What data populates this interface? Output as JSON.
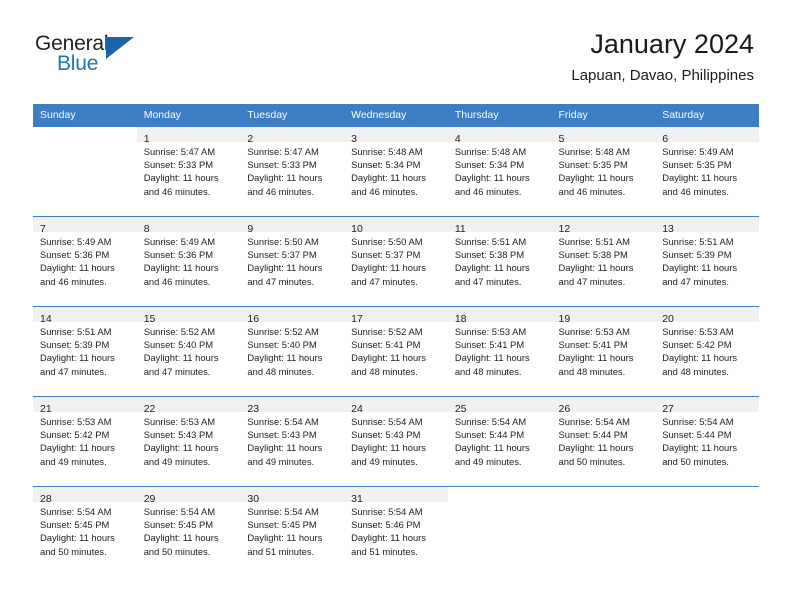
{
  "brand": {
    "name_part1": "General",
    "name_part2": "Blue",
    "accent_color": "#1c75bc",
    "triangle_color": "#1b63ad"
  },
  "header": {
    "title": "January 2024",
    "location": "Lapuan, Davao, Philippines"
  },
  "calendar": {
    "header_bg": "#3d7dc4",
    "daynum_band_bg": "#f0f0f0",
    "weekdays": [
      "Sunday",
      "Monday",
      "Tuesday",
      "Wednesday",
      "Thursday",
      "Friday",
      "Saturday"
    ],
    "weeks": [
      [
        {
          "day": "",
          "sunrise": "",
          "sunset": "",
          "daylight_line1": "",
          "daylight_line2": "",
          "empty": true
        },
        {
          "day": "1",
          "sunrise": "Sunrise: 5:47 AM",
          "sunset": "Sunset: 5:33 PM",
          "daylight_line1": "Daylight: 11 hours",
          "daylight_line2": "and 46 minutes."
        },
        {
          "day": "2",
          "sunrise": "Sunrise: 5:47 AM",
          "sunset": "Sunset: 5:33 PM",
          "daylight_line1": "Daylight: 11 hours",
          "daylight_line2": "and 46 minutes."
        },
        {
          "day": "3",
          "sunrise": "Sunrise: 5:48 AM",
          "sunset": "Sunset: 5:34 PM",
          "daylight_line1": "Daylight: 11 hours",
          "daylight_line2": "and 46 minutes."
        },
        {
          "day": "4",
          "sunrise": "Sunrise: 5:48 AM",
          "sunset": "Sunset: 5:34 PM",
          "daylight_line1": "Daylight: 11 hours",
          "daylight_line2": "and 46 minutes."
        },
        {
          "day": "5",
          "sunrise": "Sunrise: 5:48 AM",
          "sunset": "Sunset: 5:35 PM",
          "daylight_line1": "Daylight: 11 hours",
          "daylight_line2": "and 46 minutes."
        },
        {
          "day": "6",
          "sunrise": "Sunrise: 5:49 AM",
          "sunset": "Sunset: 5:35 PM",
          "daylight_line1": "Daylight: 11 hours",
          "daylight_line2": "and 46 minutes."
        }
      ],
      [
        {
          "day": "7",
          "sunrise": "Sunrise: 5:49 AM",
          "sunset": "Sunset: 5:36 PM",
          "daylight_line1": "Daylight: 11 hours",
          "daylight_line2": "and 46 minutes."
        },
        {
          "day": "8",
          "sunrise": "Sunrise: 5:49 AM",
          "sunset": "Sunset: 5:36 PM",
          "daylight_line1": "Daylight: 11 hours",
          "daylight_line2": "and 46 minutes."
        },
        {
          "day": "9",
          "sunrise": "Sunrise: 5:50 AM",
          "sunset": "Sunset: 5:37 PM",
          "daylight_line1": "Daylight: 11 hours",
          "daylight_line2": "and 47 minutes."
        },
        {
          "day": "10",
          "sunrise": "Sunrise: 5:50 AM",
          "sunset": "Sunset: 5:37 PM",
          "daylight_line1": "Daylight: 11 hours",
          "daylight_line2": "and 47 minutes."
        },
        {
          "day": "11",
          "sunrise": "Sunrise: 5:51 AM",
          "sunset": "Sunset: 5:38 PM",
          "daylight_line1": "Daylight: 11 hours",
          "daylight_line2": "and 47 minutes."
        },
        {
          "day": "12",
          "sunrise": "Sunrise: 5:51 AM",
          "sunset": "Sunset: 5:38 PM",
          "daylight_line1": "Daylight: 11 hours",
          "daylight_line2": "and 47 minutes."
        },
        {
          "day": "13",
          "sunrise": "Sunrise: 5:51 AM",
          "sunset": "Sunset: 5:39 PM",
          "daylight_line1": "Daylight: 11 hours",
          "daylight_line2": "and 47 minutes."
        }
      ],
      [
        {
          "day": "14",
          "sunrise": "Sunrise: 5:51 AM",
          "sunset": "Sunset: 5:39 PM",
          "daylight_line1": "Daylight: 11 hours",
          "daylight_line2": "and 47 minutes."
        },
        {
          "day": "15",
          "sunrise": "Sunrise: 5:52 AM",
          "sunset": "Sunset: 5:40 PM",
          "daylight_line1": "Daylight: 11 hours",
          "daylight_line2": "and 47 minutes."
        },
        {
          "day": "16",
          "sunrise": "Sunrise: 5:52 AM",
          "sunset": "Sunset: 5:40 PM",
          "daylight_line1": "Daylight: 11 hours",
          "daylight_line2": "and 48 minutes."
        },
        {
          "day": "17",
          "sunrise": "Sunrise: 5:52 AM",
          "sunset": "Sunset: 5:41 PM",
          "daylight_line1": "Daylight: 11 hours",
          "daylight_line2": "and 48 minutes."
        },
        {
          "day": "18",
          "sunrise": "Sunrise: 5:53 AM",
          "sunset": "Sunset: 5:41 PM",
          "daylight_line1": "Daylight: 11 hours",
          "daylight_line2": "and 48 minutes."
        },
        {
          "day": "19",
          "sunrise": "Sunrise: 5:53 AM",
          "sunset": "Sunset: 5:41 PM",
          "daylight_line1": "Daylight: 11 hours",
          "daylight_line2": "and 48 minutes."
        },
        {
          "day": "20",
          "sunrise": "Sunrise: 5:53 AM",
          "sunset": "Sunset: 5:42 PM",
          "daylight_line1": "Daylight: 11 hours",
          "daylight_line2": "and 48 minutes."
        }
      ],
      [
        {
          "day": "21",
          "sunrise": "Sunrise: 5:53 AM",
          "sunset": "Sunset: 5:42 PM",
          "daylight_line1": "Daylight: 11 hours",
          "daylight_line2": "and 49 minutes."
        },
        {
          "day": "22",
          "sunrise": "Sunrise: 5:53 AM",
          "sunset": "Sunset: 5:43 PM",
          "daylight_line1": "Daylight: 11 hours",
          "daylight_line2": "and 49 minutes."
        },
        {
          "day": "23",
          "sunrise": "Sunrise: 5:54 AM",
          "sunset": "Sunset: 5:43 PM",
          "daylight_line1": "Daylight: 11 hours",
          "daylight_line2": "and 49 minutes."
        },
        {
          "day": "24",
          "sunrise": "Sunrise: 5:54 AM",
          "sunset": "Sunset: 5:43 PM",
          "daylight_line1": "Daylight: 11 hours",
          "daylight_line2": "and 49 minutes."
        },
        {
          "day": "25",
          "sunrise": "Sunrise: 5:54 AM",
          "sunset": "Sunset: 5:44 PM",
          "daylight_line1": "Daylight: 11 hours",
          "daylight_line2": "and 49 minutes."
        },
        {
          "day": "26",
          "sunrise": "Sunrise: 5:54 AM",
          "sunset": "Sunset: 5:44 PM",
          "daylight_line1": "Daylight: 11 hours",
          "daylight_line2": "and 50 minutes."
        },
        {
          "day": "27",
          "sunrise": "Sunrise: 5:54 AM",
          "sunset": "Sunset: 5:44 PM",
          "daylight_line1": "Daylight: 11 hours",
          "daylight_line2": "and 50 minutes."
        }
      ],
      [
        {
          "day": "28",
          "sunrise": "Sunrise: 5:54 AM",
          "sunset": "Sunset: 5:45 PM",
          "daylight_line1": "Daylight: 11 hours",
          "daylight_line2": "and 50 minutes."
        },
        {
          "day": "29",
          "sunrise": "Sunrise: 5:54 AM",
          "sunset": "Sunset: 5:45 PM",
          "daylight_line1": "Daylight: 11 hours",
          "daylight_line2": "and 50 minutes."
        },
        {
          "day": "30",
          "sunrise": "Sunrise: 5:54 AM",
          "sunset": "Sunset: 5:45 PM",
          "daylight_line1": "Daylight: 11 hours",
          "daylight_line2": "and 51 minutes."
        },
        {
          "day": "31",
          "sunrise": "Sunrise: 5:54 AM",
          "sunset": "Sunset: 5:46 PM",
          "daylight_line1": "Daylight: 11 hours",
          "daylight_line2": "and 51 minutes."
        },
        {
          "day": "",
          "sunrise": "",
          "sunset": "",
          "daylight_line1": "",
          "daylight_line2": "",
          "empty": true
        },
        {
          "day": "",
          "sunrise": "",
          "sunset": "",
          "daylight_line1": "",
          "daylight_line2": "",
          "empty": true
        },
        {
          "day": "",
          "sunrise": "",
          "sunset": "",
          "daylight_line1": "",
          "daylight_line2": "",
          "empty": true
        }
      ]
    ]
  }
}
